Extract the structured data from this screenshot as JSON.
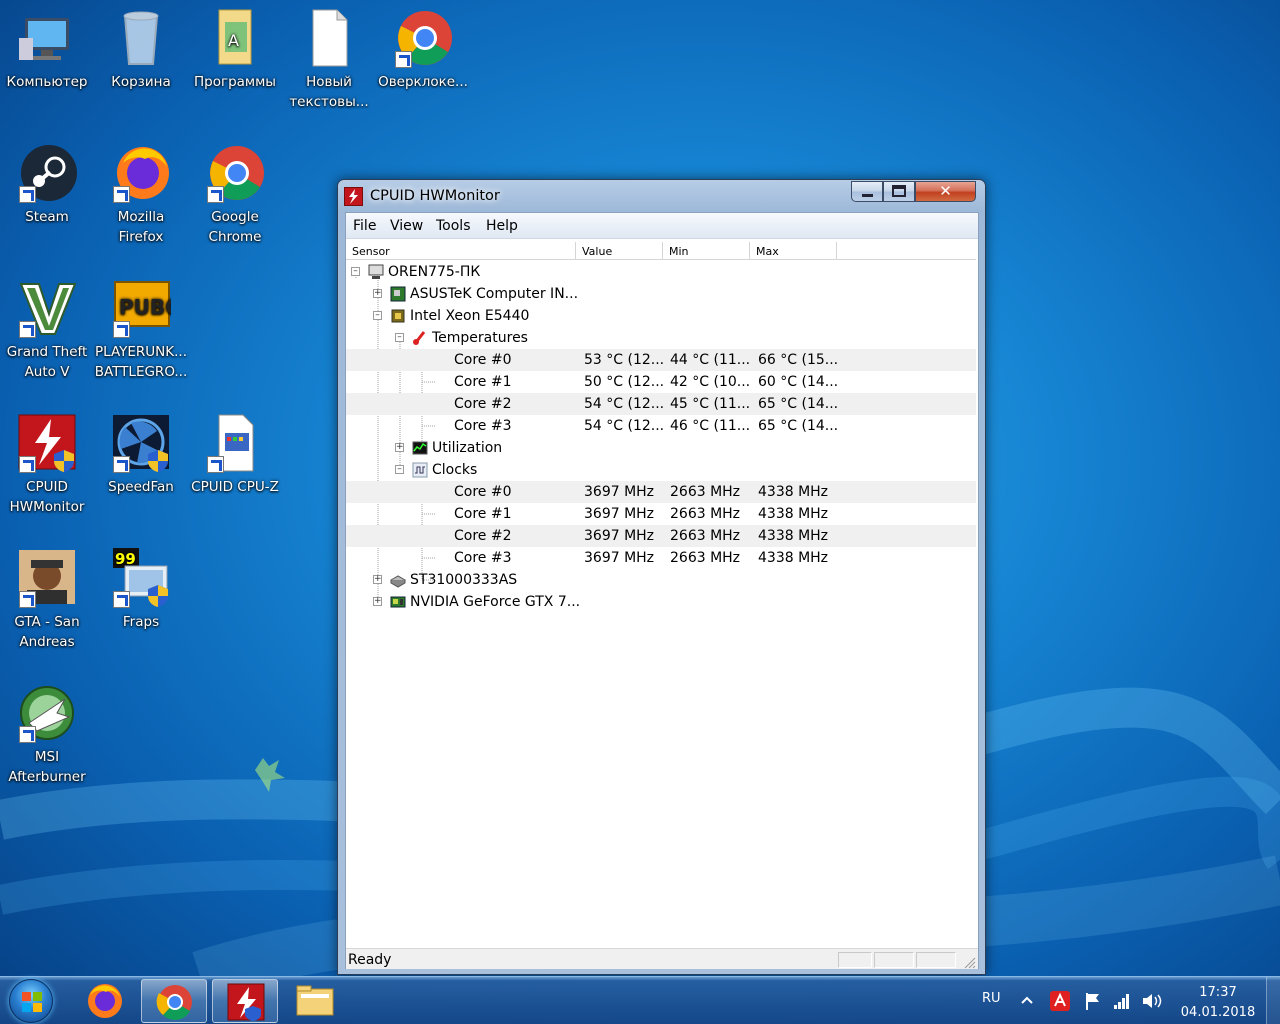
{
  "desktop": {
    "icons": [
      {
        "label": "Компьютер"
      },
      {
        "label": "Корзина"
      },
      {
        "label": "Программы"
      },
      {
        "label": "Новый текстовы..."
      },
      {
        "label": "Оверклоке..."
      },
      {
        "label": "Steam"
      },
      {
        "label": "Mozilla Firefox"
      },
      {
        "label": "Google Chrome"
      },
      {
        "label": "Grand Theft Auto V"
      },
      {
        "label": "PLAYERUNK... BATTLEGRO..."
      },
      {
        "label": "CPUID HWMonitor"
      },
      {
        "label": "SpeedFan"
      },
      {
        "label": "CPUID CPU-Z"
      },
      {
        "label": "GTA - San Andreas"
      },
      {
        "label": "Fraps"
      },
      {
        "label": "MSI Afterburner"
      }
    ],
    "pubg_logo_text": "PUBG",
    "fraps_logo_text": "99"
  },
  "window": {
    "title": "CPUID HWMonitor",
    "menu": [
      "File",
      "View",
      "Tools",
      "Help"
    ],
    "columns": [
      "Sensor",
      "Value",
      "Min",
      "Max"
    ],
    "tree": [
      {
        "name": "OREN775-ПК",
        "value": "",
        "min": "",
        "max": ""
      },
      {
        "name": "ASUSTeK Computer IN...",
        "value": "",
        "min": "",
        "max": ""
      },
      {
        "name": "Intel Xeon E5440",
        "value": "",
        "min": "",
        "max": ""
      },
      {
        "name": "Temperatures",
        "value": "",
        "min": "",
        "max": ""
      },
      {
        "name": "Core #0",
        "value": "53 °C  (12...",
        "min": "44 °C  (11...",
        "max": "66 °C  (15..."
      },
      {
        "name": "Core #1",
        "value": "50 °C  (12...",
        "min": "42 °C  (10...",
        "max": "60 °C  (14..."
      },
      {
        "name": "Core #2",
        "value": "54 °C  (12...",
        "min": "45 °C  (11...",
        "max": "65 °C  (14..."
      },
      {
        "name": "Core #3",
        "value": "54 °C  (12...",
        "min": "46 °C  (11...",
        "max": "65 °C  (14..."
      },
      {
        "name": "Utilization",
        "value": "",
        "min": "",
        "max": ""
      },
      {
        "name": "Clocks",
        "value": "",
        "min": "",
        "max": ""
      },
      {
        "name": "Core #0",
        "value": "3697 MHz",
        "min": "2663 MHz",
        "max": "4338 MHz"
      },
      {
        "name": "Core #1",
        "value": "3697 MHz",
        "min": "2663 MHz",
        "max": "4338 MHz"
      },
      {
        "name": "Core #2",
        "value": "3697 MHz",
        "min": "2663 MHz",
        "max": "4338 MHz"
      },
      {
        "name": "Core #3",
        "value": "3697 MHz",
        "min": "2663 MHz",
        "max": "4338 MHz"
      },
      {
        "name": "ST31000333AS",
        "value": "",
        "min": "",
        "max": ""
      },
      {
        "name": "NVIDIA GeForce GTX 7...",
        "value": "",
        "min": "",
        "max": ""
      }
    ],
    "status": "Ready",
    "caption_buttons": {
      "close": "✕"
    }
  },
  "taskbar": {
    "language": "RU",
    "time": "17:37",
    "date": "04.01.2018"
  },
  "colors": {
    "accent_red": "#c3161c",
    "desktop_blue": "#1684d2"
  }
}
